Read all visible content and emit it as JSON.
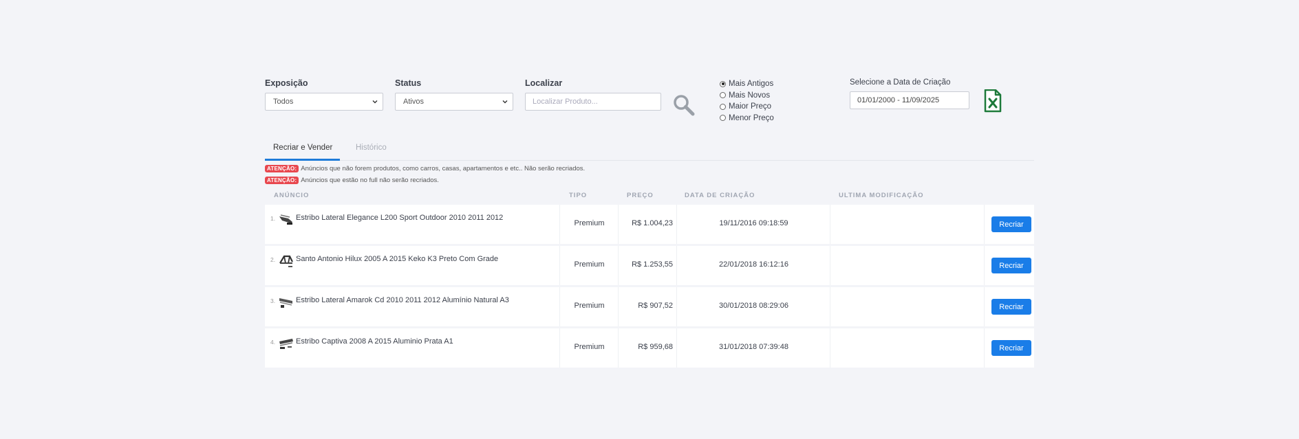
{
  "filters": {
    "exposicao": {
      "label": "Exposição",
      "value": "Todos"
    },
    "status": {
      "label": "Status",
      "value": "Ativos"
    },
    "localizar": {
      "label": "Localizar",
      "placeholder": "Localizar Produto..."
    },
    "sort_options": [
      {
        "label": "Mais Antigos",
        "selected": true
      },
      {
        "label": "Mais Novos",
        "selected": false
      },
      {
        "label": "Maior Preço",
        "selected": false
      },
      {
        "label": "Menor Preço",
        "selected": false
      }
    ],
    "date": {
      "label": "Selecione a Data de Criação",
      "value": "01/01/2000 - 11/09/2025"
    }
  },
  "icons": {
    "search": "search-icon",
    "excel": "excel-icon"
  },
  "colors": {
    "primary": "#1a7de8",
    "badge": "#e8474e",
    "excel": "#1d7a3a"
  },
  "tabs": [
    {
      "label": "Recriar e Vender",
      "active": true
    },
    {
      "label": "Histórico",
      "active": false
    }
  ],
  "alerts": [
    {
      "badge": "ATENÇÃO:",
      "text": "Anúncios que não forem produtos, como carros, casas, apartamentos e etc.. Não serão recriados."
    },
    {
      "badge": "ATENÇÃO:",
      "text": "Anúncios que estão no full não serão recriados."
    }
  ],
  "table": {
    "headers": [
      "ANÚNCIO",
      "TIPO",
      "PREÇO",
      "DATA DE CRIAÇÃO",
      "ULTIMA MODIFICAÇÃO"
    ],
    "rows": [
      {
        "index": "1.",
        "title": "Estribo Lateral Elegance L200 Sport Outdoor 2010 2011 2012",
        "tipo": "Premium",
        "preco": "R$ 1.004,23",
        "data": "19/11/2016 09:18:59",
        "modificacao": "",
        "action": "Recriar"
      },
      {
        "index": "2.",
        "title": "Santo Antonio Hilux 2005 A 2015 Keko K3 Preto Com Grade",
        "tipo": "Premium",
        "preco": "R$ 1.253,55",
        "data": "22/01/2018 16:12:16",
        "modificacao": "",
        "action": "Recriar"
      },
      {
        "index": "3.",
        "title": "Estribo Lateral Amarok Cd 2010 2011 2012 Alumínio Natural A3",
        "tipo": "Premium",
        "preco": "R$ 907,52",
        "data": "30/01/2018 08:29:06",
        "modificacao": "",
        "action": "Recriar"
      },
      {
        "index": "4.",
        "title": "Estribo Captiva 2008 A 2015 Aluminio Prata A1",
        "tipo": "Premium",
        "preco": "R$ 959,68",
        "data": "31/01/2018 07:39:48",
        "modificacao": "",
        "action": "Recriar"
      }
    ]
  }
}
